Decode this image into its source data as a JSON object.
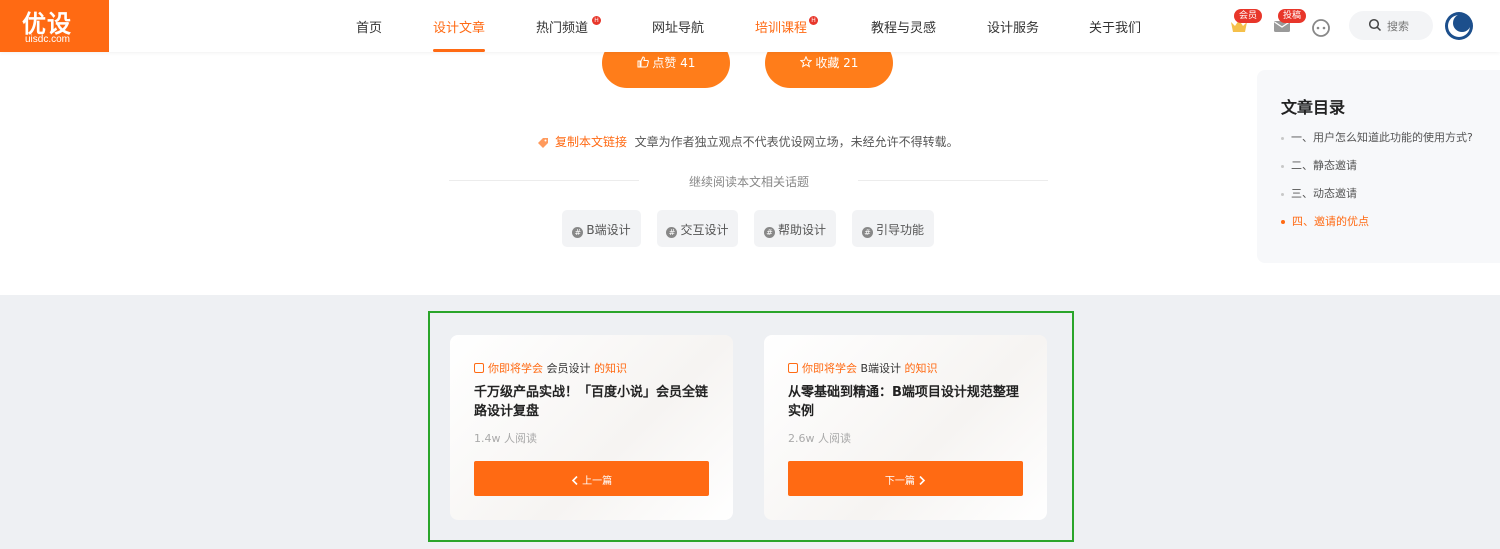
{
  "logo": {
    "mark": "优设",
    "sub": "uisdc.com"
  },
  "nav": {
    "items": [
      "首页",
      "设计文章",
      "热门频道",
      "网址导航",
      "培训课程",
      "教程与灵感",
      "设计服务",
      "关于我们"
    ],
    "hot_badge": "H"
  },
  "header": {
    "member_badge": "会员",
    "submit_badge": "投稿",
    "search_placeholder": "搜索"
  },
  "actions": {
    "like": "点赞 41",
    "collect": "收藏 21"
  },
  "copy": {
    "link_label": "复制本文链接",
    "notice": "文章为作者独立观点不代表优设网立场，未经允许不得转载。"
  },
  "related": {
    "title": "继续阅读本文相关话题",
    "topics": [
      "B端设计",
      "交互设计",
      "帮助设计",
      "引导功能"
    ],
    "topic_icon": "#"
  },
  "toc": {
    "title": "文章目录",
    "items": [
      "一、用户怎么知道此功能的使用方式?",
      "二、静态邀请",
      "三、动态邀请",
      "四、邀请的优点"
    ]
  },
  "cards": [
    {
      "learn_prefix": "你即将学会",
      "topic": "会员设计",
      "learn_suffix": "的知识",
      "title": "千万级产品实战！「百度小说」会员全链路设计复盘",
      "reads": "1.4w 人阅读",
      "button": "上一篇"
    },
    {
      "learn_prefix": "你即将学会",
      "topic": "B端设计",
      "learn_suffix": "的知识",
      "title": "从零基础到精通：B端项目设计规范整理实例",
      "reads": "2.6w 人阅读",
      "button": "下一篇"
    }
  ],
  "colors": {
    "brand": "#ff6a13",
    "frame": "#2aa52a"
  }
}
